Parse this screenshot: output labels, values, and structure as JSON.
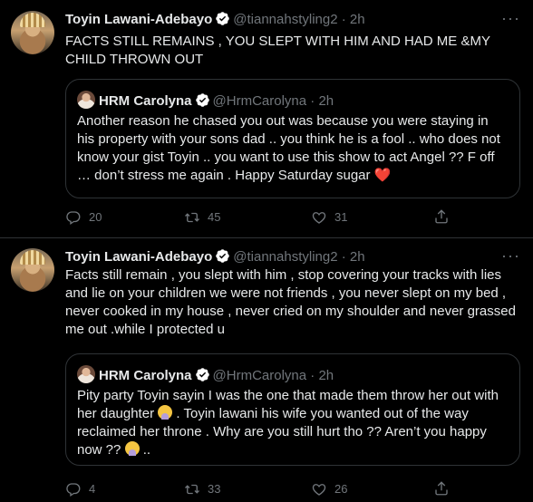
{
  "tweets": [
    {
      "author_name": "Toyin Lawani-Adebayo",
      "handle": "@tiannahstyling2",
      "time": "2h",
      "separator": "·",
      "text": "FACTS STILL REMAINS , YOU SLEPT WITH HIM AND HAD ME &MY CHILD THROWN OUT",
      "quote": {
        "author_name": "HRM Carolyna",
        "handle": "@HrmCarolyna",
        "time": "2h",
        "text_main": "Another reason he chased you out was because you were staying in his property with your sons dad .. you think he is a fool .. who does not know your gist Toyin .. you want to use this show to act Angel ?? F off … don’t stress me again . Happy Saturday sugar",
        "emoji": "❤️"
      },
      "replies": "20",
      "retweets": "45",
      "likes": "31"
    },
    {
      "author_name": "Toyin Lawani-Adebayo",
      "handle": "@tiannahstyling2",
      "time": "2h",
      "separator": "·",
      "text": "Facts still remain , you slept with him , stop covering your tracks with lies and lie on your children we were not friends , you never slept on my bed , never cooked in my house , never cried on my shoulder and never grassed me out .while I protected u",
      "quote": {
        "author_name": "HRM Carolyna",
        "handle": "@HrmCarolyna",
        "time": "2h",
        "text_part1": "Pity party Toyin sayin I was the one that made them throw her out with her daughter",
        "emoji": "🤦‍♀️",
        "text_part2": ". Toyin lawani his wife you wanted out of the way reclaimed her throne . Why are you still hurt tho ?? Aren’t you happy now ??",
        "text_part3": ".."
      },
      "replies": "4",
      "retweets": "33",
      "likes": "26"
    }
  ],
  "icons": {
    "verified": "verified-badge-icon",
    "more": "more-icon",
    "reply": "reply-icon",
    "retweet": "retweet-icon",
    "like": "heart-icon",
    "share": "share-icon"
  },
  "colors": {
    "background": "#000000",
    "text": "#e7e9ea",
    "muted": "#71767b",
    "verified": "#ffffff",
    "heart_emoji": "#f91880",
    "border": "#2f3336"
  }
}
